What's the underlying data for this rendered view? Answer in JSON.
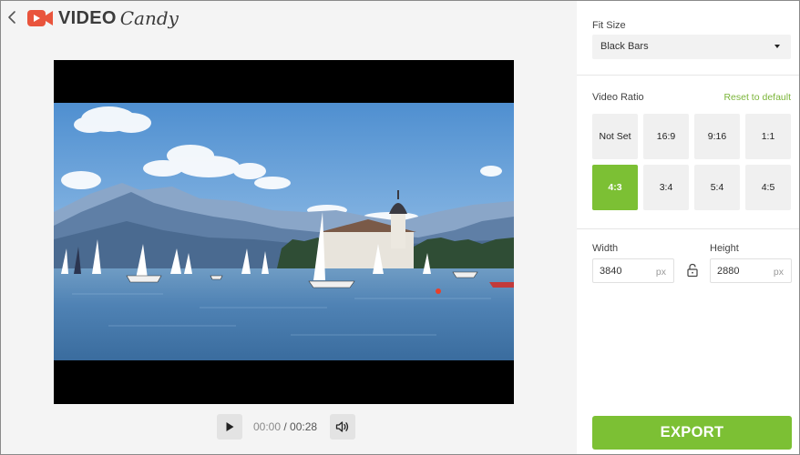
{
  "logo": {
    "word1": "VIDEO",
    "word2": "Candy",
    "brand_color": "#e9543c"
  },
  "player": {
    "current_time": "00:00",
    "separator": " / ",
    "duration": "00:28",
    "play_icon": "play-icon",
    "volume_icon": "volume-icon"
  },
  "panel": {
    "fit_size": {
      "label": "Fit Size",
      "value": "Black Bars"
    },
    "video_ratio": {
      "label": "Video Ratio",
      "reset_label": "Reset to default",
      "options": [
        "Not Set",
        "16:9",
        "9:16",
        "1:1",
        "4:3",
        "3:4",
        "5:4",
        "4:5"
      ],
      "selected": "4:3"
    },
    "width": {
      "label": "Width",
      "value": "3840",
      "unit": "px"
    },
    "height": {
      "label": "Height",
      "value": "2880",
      "unit": "px"
    },
    "export_label": "EXPORT"
  },
  "colors": {
    "accent_green": "#7cc034",
    "link_green": "#7bb53a",
    "brand_red": "#e9543c"
  }
}
